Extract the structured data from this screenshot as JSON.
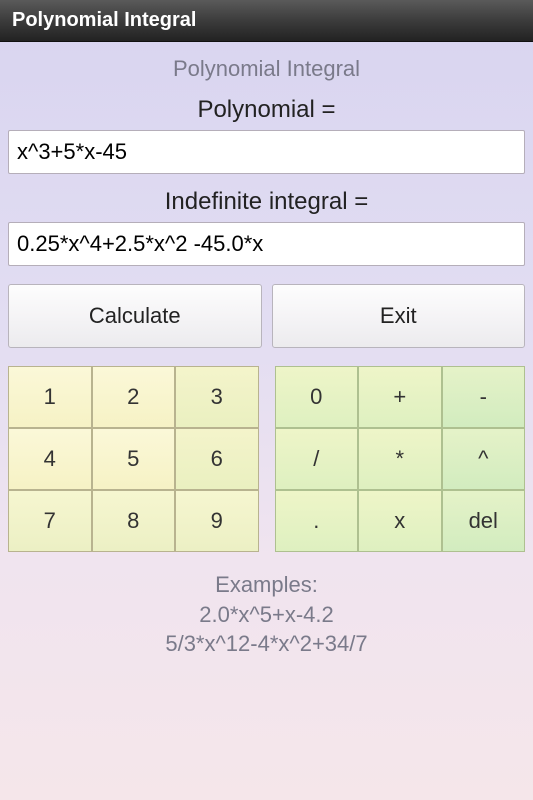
{
  "titlebar": "Polynomial Integral",
  "subtitle": "Polynomial Integral",
  "labels": {
    "polynomial": "Polynomial =",
    "integral": "Indefinite integral ="
  },
  "fields": {
    "polynomial_value": "x^3+5*x-45",
    "integral_value": "0.25*x^4+2.5*x^2 -45.0*x"
  },
  "actions": {
    "calculate": "Calculate",
    "exit": "Exit"
  },
  "keypad_numbers": [
    "1",
    "2",
    "3",
    "4",
    "5",
    "6",
    "7",
    "8",
    "9"
  ],
  "keypad_ops": [
    "0",
    "+",
    "-",
    "/",
    "*",
    "^",
    ".",
    "x",
    "del"
  ],
  "examples": {
    "header": "Examples:",
    "line1": "2.0*x^5+x-4.2",
    "line2": "5/3*x^12-4*x^2+34/7"
  }
}
